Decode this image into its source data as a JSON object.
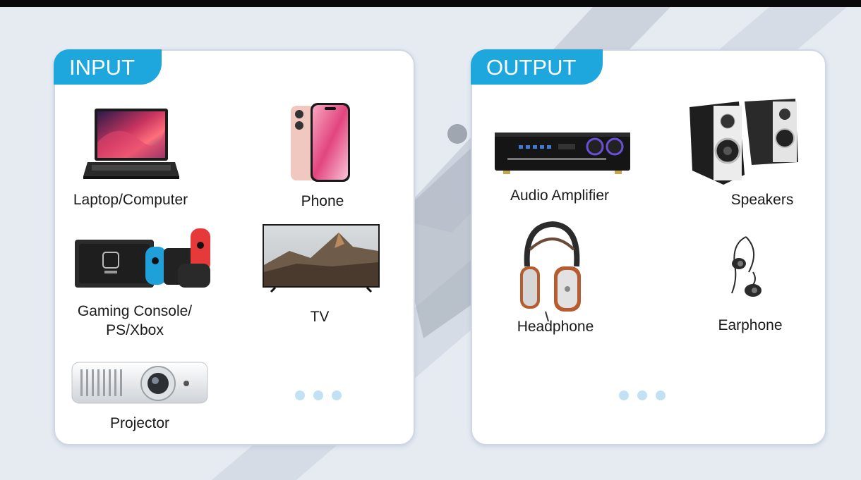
{
  "input": {
    "tab_label": "INPUT",
    "items": [
      {
        "label": "Laptop/Computer"
      },
      {
        "label": "Phone"
      },
      {
        "label": "Gaming Console/",
        "label2": "PS/Xbox"
      },
      {
        "label": "TV"
      },
      {
        "label": "Projector"
      }
    ]
  },
  "output": {
    "tab_label": "OUTPUT",
    "items": [
      {
        "label": "Audio Amplifier"
      },
      {
        "label": "Speakers"
      },
      {
        "label": "Headphone"
      },
      {
        "label": "Earphone"
      }
    ]
  },
  "colors": {
    "accent": "#1ea7dd",
    "dots": "#c2e2f4",
    "panel_border": "#cfd7e2"
  }
}
